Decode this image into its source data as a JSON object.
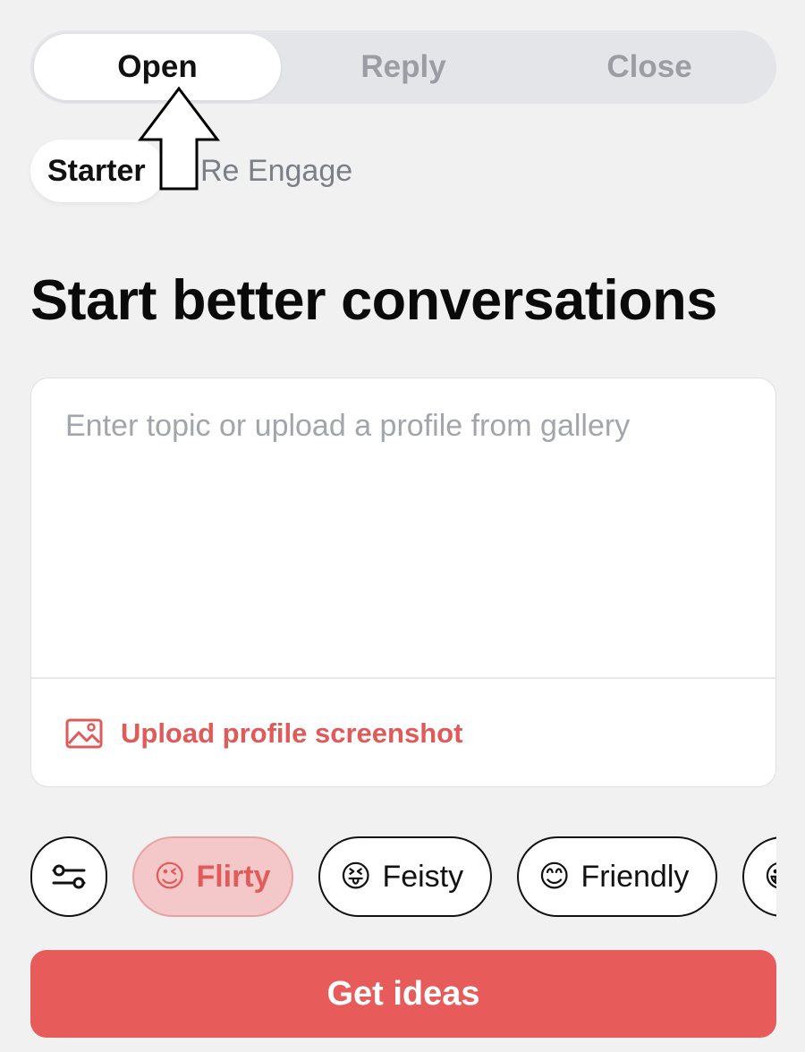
{
  "mode_tabs": [
    {
      "label": "Open",
      "active": true
    },
    {
      "label": "Reply",
      "active": false
    },
    {
      "label": "Close",
      "active": false
    }
  ],
  "sub_tabs": [
    {
      "label": "Starter",
      "active": true
    },
    {
      "label": "Re Engage",
      "active": false
    }
  ],
  "headline": "Start better conversations",
  "topic_input": {
    "placeholder": "Enter topic or upload a profile from gallery",
    "value": ""
  },
  "upload": {
    "label": "Upload profile screenshot",
    "icon": "image-icon"
  },
  "tone_chips": [
    {
      "emoji": "😉",
      "label": "Flirty",
      "selected": true
    },
    {
      "emoji": "😝",
      "label": "Feisty",
      "selected": false
    },
    {
      "emoji": "😊",
      "label": "Friendly",
      "selected": false
    },
    {
      "emoji": "😀",
      "label": "",
      "selected": false
    }
  ],
  "cta_label": "Get ideas",
  "colors": {
    "accent": "#e85b5b",
    "accent_light": "#f4c8c8",
    "background": "#f1f1f2"
  }
}
